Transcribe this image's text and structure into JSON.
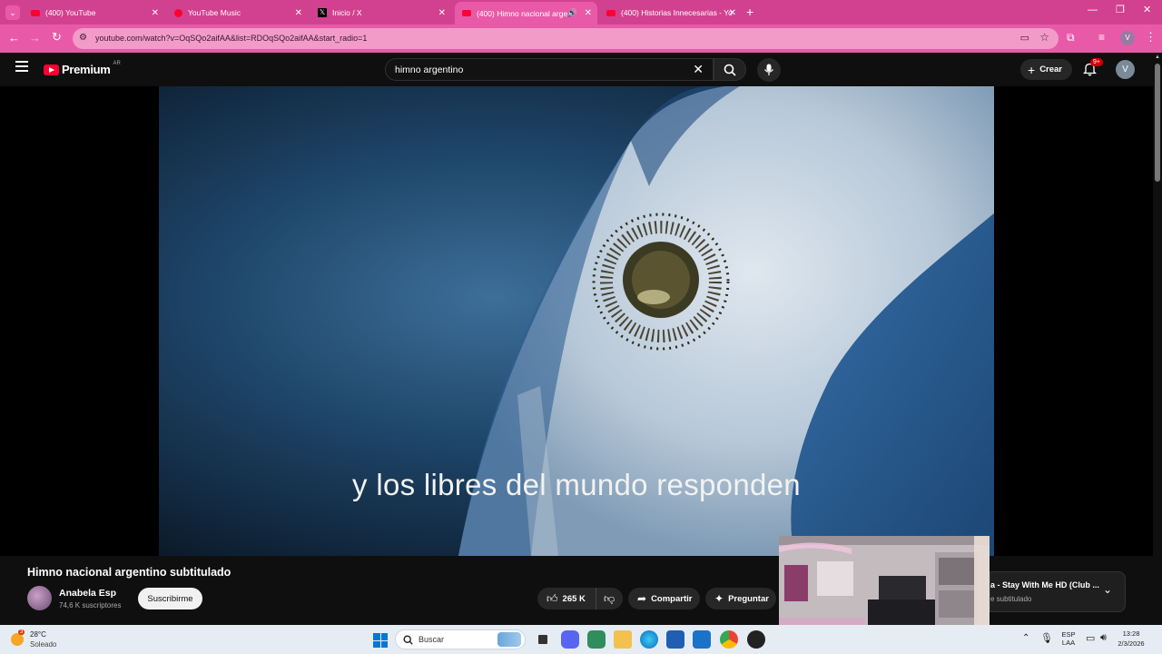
{
  "browser": {
    "tabs": [
      {
        "title": "(400) YouTube",
        "icon": "youtube-icon"
      },
      {
        "title": "YouTube Music",
        "icon": "youtube-music-icon"
      },
      {
        "title": "Inicio / X",
        "icon": "x-icon"
      },
      {
        "title": "(400) Himno nacional arge",
        "icon": "youtube-icon",
        "active": true
      },
      {
        "title": "(400) Historias Innecesarias - Yo",
        "icon": "youtube-icon"
      }
    ],
    "url": "youtube.com/watch?v=OqSQo2aifAA&list=RDOqSQo2aifAA&start_radio=1",
    "accent_color": "#e85aa7"
  },
  "youtube": {
    "logo_text": "Premium",
    "region": "AR",
    "search_value": "himno argentino",
    "create_label": "Crear",
    "notification_badge": "9+",
    "user_initial": "V"
  },
  "video": {
    "subtitle": "y los libres del mundo responden",
    "title": "Himno nacional argentino subtitulado",
    "channel": "Anabela Esp",
    "subscribers": "74,6 K suscriptores",
    "subscribe_label": "Suscribirme",
    "likes": "265 K",
    "share_label": "Compartir",
    "ask_label": "Preguntar"
  },
  "playlist_card": {
    "title": "a - Stay With Me HD (Club ...",
    "subtitle": "e subtitulado"
  },
  "taskbar": {
    "weather_temp": "28°C",
    "weather_desc": "Soleado",
    "weather_badge": "3",
    "search_placeholder": "Buscar",
    "lang_top": "ESP",
    "lang_bottom": "LAA",
    "time": "13:28",
    "date": "2/3/2026"
  }
}
